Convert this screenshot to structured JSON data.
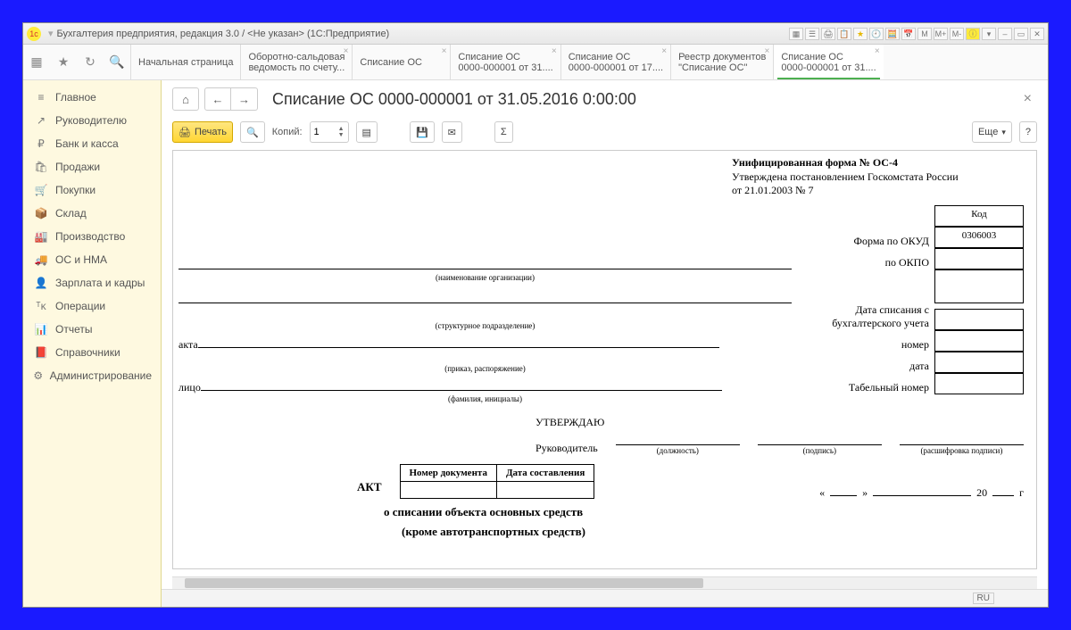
{
  "window_title": "Бухгалтерия предприятия, редакция 3.0 / <Не указан>  (1С:Предприятие)",
  "tabs": [
    {
      "l1": "Начальная страница",
      "l2": ""
    },
    {
      "l1": "Оборотно-сальдовая",
      "l2": "ведомость по счету..."
    },
    {
      "l1": "Списание ОС",
      "l2": ""
    },
    {
      "l1": "Списание ОС",
      "l2": "0000-000001 от 31...."
    },
    {
      "l1": "Списание ОС",
      "l2": "0000-000001 от 17...."
    },
    {
      "l1": "Реестр документов",
      "l2": "\"Списание ОС\""
    },
    {
      "l1": "Списание ОС",
      "l2": "0000-000001 от 31...."
    }
  ],
  "sidebar": [
    {
      "icon": "≡",
      "label": "Главное"
    },
    {
      "icon": "↗",
      "label": "Руководителю"
    },
    {
      "icon": "₽",
      "label": "Банк и касса"
    },
    {
      "icon": "🛍",
      "label": "Продажи"
    },
    {
      "icon": "🛒",
      "label": "Покупки"
    },
    {
      "icon": "📦",
      "label": "Склад"
    },
    {
      "icon": "🏭",
      "label": "Производство"
    },
    {
      "icon": "🚚",
      "label": "ОС и НМА"
    },
    {
      "icon": "👤",
      "label": "Зарплата и кадры"
    },
    {
      "icon": "ᵀᴋ",
      "label": "Операции"
    },
    {
      "icon": "📊",
      "label": "Отчеты"
    },
    {
      "icon": "📕",
      "label": "Справочники"
    },
    {
      "icon": "⚙",
      "label": "Администрирование"
    }
  ],
  "page_title": "Списание ОС 0000-000001 от 31.05.2016 0:00:00",
  "toolbar": {
    "print": "Печать",
    "copies_label": "Копий:",
    "copies_value": "1",
    "more": "Еще",
    "help": "?"
  },
  "doc": {
    "form_title": "Унифицированная форма № ОС-4",
    "form_approved": "Утверждена постановлением Госкомстата России",
    "form_date": "от 21.01.2003 № 7",
    "kod": "Код",
    "okud_label": "Форма по ОКУД",
    "okud_value": "0306003",
    "okpo_label": "по ОКПО",
    "org_cap": "(наименование организации)",
    "dept_cap": "(структурное подразделение)",
    "date_writeoff": "Дата списания с бухгалтерского учета",
    "akta": "акта",
    "order_cap": "(приказ, распоряжение)",
    "number": "номер",
    "date": "дата",
    "litso": "лицо",
    "fio_cap": "(фамилия, инициалы)",
    "tab_number": "Табельный номер",
    "approve": "УТВЕРЖДАЮ",
    "head": "Руководитель",
    "position_cap": "(должность)",
    "sign_cap": "(подпись)",
    "decipher_cap": "(расшифровка подписи)",
    "akt": "АКТ",
    "doc_no": "Номер документа",
    "doc_date": "Дата составления",
    "quote_l": "«",
    "quote_r": "»",
    "year20": "20",
    "year_g": "г",
    "subtitle1": "о списании объекта основных средств",
    "subtitle2": "(кроме автотранспортных средств)"
  },
  "status_lang": "RU"
}
